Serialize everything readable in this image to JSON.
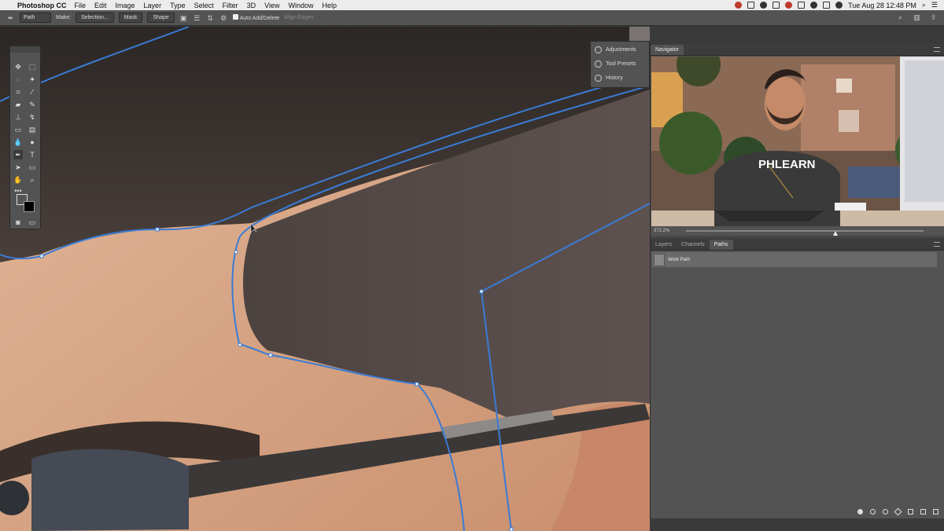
{
  "menubar": {
    "app": "Photoshop CC",
    "menus": [
      "File",
      "Edit",
      "Image",
      "Layer",
      "Type",
      "Select",
      "Filter",
      "3D",
      "View",
      "Window",
      "Help"
    ],
    "clock": "Tue Aug 28  12:48 PM"
  },
  "options": {
    "mode": "Path",
    "make_label": "Make:",
    "selection": "Selection...",
    "mask": "Mask",
    "shape": "Shape",
    "auto_add_delete": "Auto Add/Delete",
    "align_edges": "Align Edges"
  },
  "collapsed_panels": [
    "Adjustments",
    "Tool Presets",
    "History"
  ],
  "navigator": {
    "title": "Navigator",
    "zoom": "372.2%",
    "shirt_text": "PHLEARN"
  },
  "layers_panel": {
    "tabs": [
      "Layers",
      "Channels",
      "Paths"
    ],
    "active_tab": "Paths",
    "work_path": "Work Path"
  },
  "colors": {
    "path_blue": "#3a7bd5",
    "panel_bg": "#535353",
    "skin": "#d4a07f",
    "hair": "#2e2a28"
  }
}
